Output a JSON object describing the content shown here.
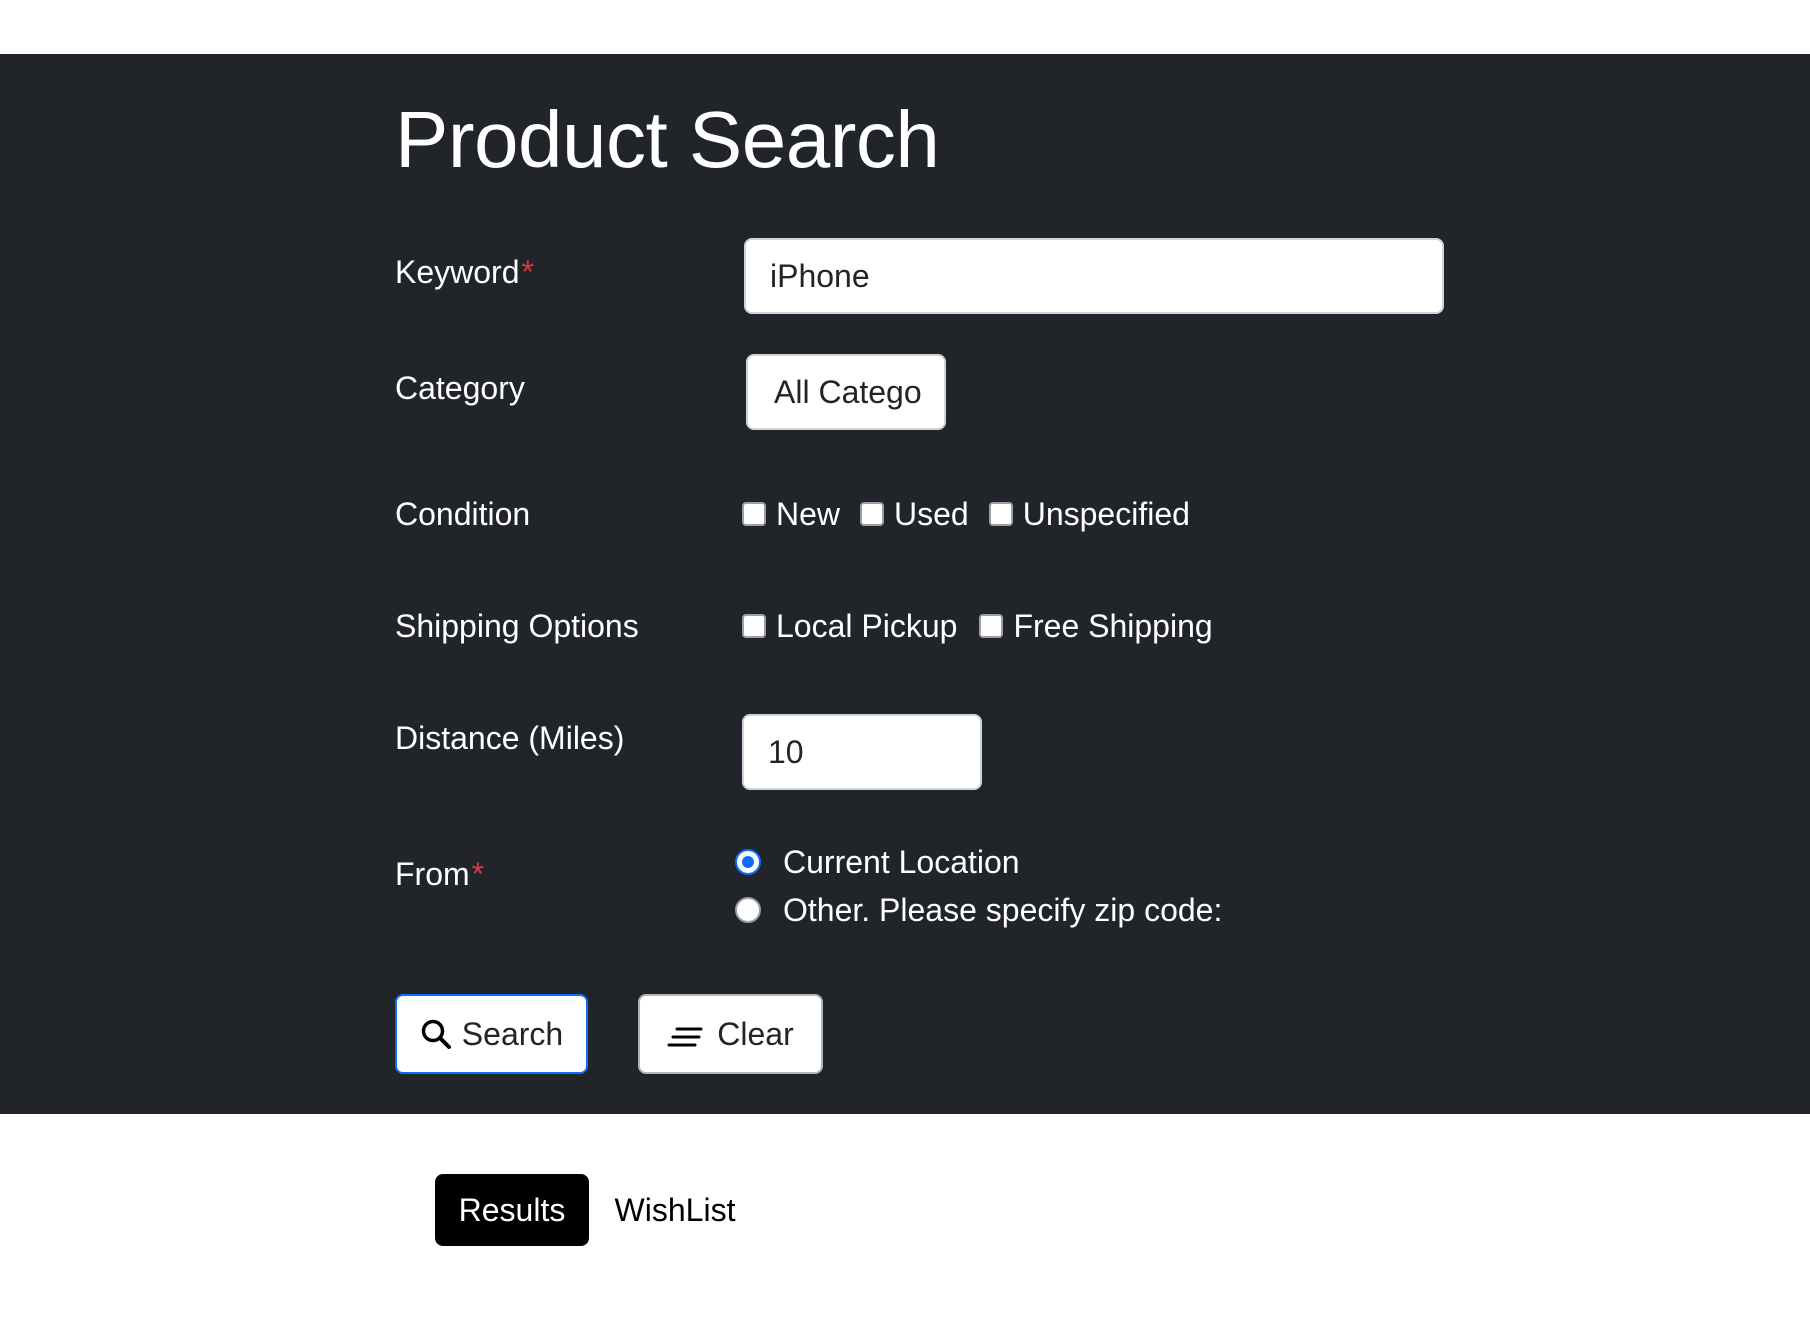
{
  "page": {
    "title": "Product Search"
  },
  "form": {
    "keyword": {
      "label": "Keyword",
      "required_mark": "*",
      "value": "iPhone"
    },
    "category": {
      "label": "Category",
      "selected": "All Catego"
    },
    "condition": {
      "label": "Condition",
      "options": [
        {
          "label": "New",
          "checked": false
        },
        {
          "label": "Used",
          "checked": false
        },
        {
          "label": "Unspecified",
          "checked": false
        }
      ]
    },
    "shipping": {
      "label": "Shipping Options",
      "options": [
        {
          "label": "Local Pickup",
          "checked": false
        },
        {
          "label": "Free Shipping",
          "checked": false
        }
      ]
    },
    "distance": {
      "label": "Distance (Miles)",
      "value": "10"
    },
    "from": {
      "label": "From",
      "required_mark": "*",
      "options": [
        {
          "label": "Current Location",
          "selected": true
        },
        {
          "label": "Other. Please specify zip code:",
          "selected": false
        }
      ]
    }
  },
  "buttons": {
    "search_label": "Search",
    "search_icon": "search-icon",
    "clear_label": "Clear",
    "clear_icon": "clear-lines-icon"
  },
  "tabs": [
    {
      "label": "Results",
      "active": true
    },
    {
      "label": "WishList",
      "active": false
    }
  ],
  "colors": {
    "panel_bg": "#212529",
    "accent": "#0d6efd",
    "required": "#dc3545"
  }
}
